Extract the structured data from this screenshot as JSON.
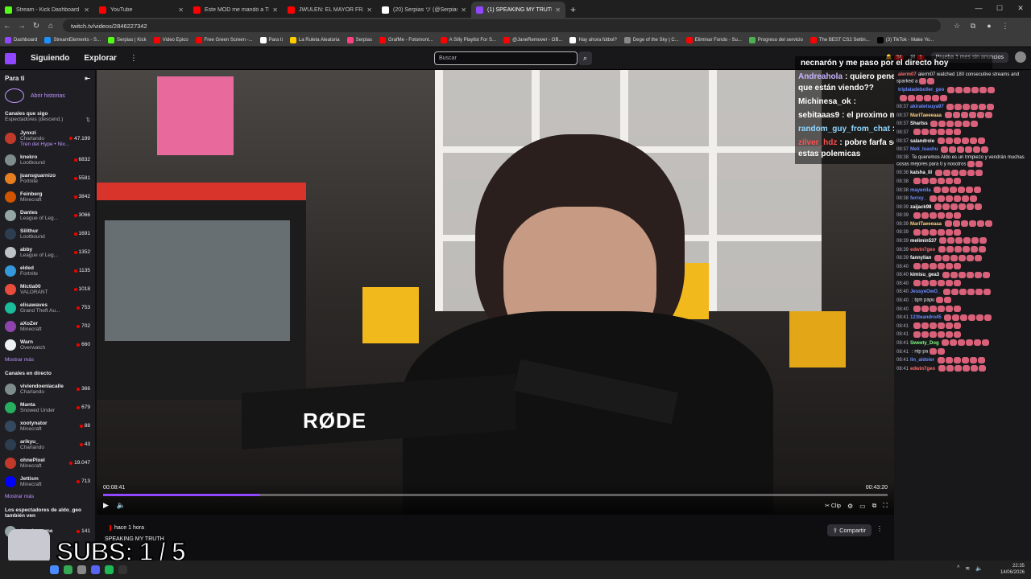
{
  "browser": {
    "tabs": [
      {
        "title": "Stream - Kick Dashboard",
        "color": "#53fc18",
        "active": false
      },
      {
        "title": "YouTube",
        "color": "#ff0000",
        "active": false
      },
      {
        "title": "Este MOD me mandó a TERAPIA",
        "color": "#ff0000",
        "active": false
      },
      {
        "title": "JWULEN: EL MAYOR FRAUDE DE",
        "color": "#ff0000",
        "active": false
      },
      {
        "title": "(20) Serpias ツ (@Serpias) / X",
        "color": "#ffffff",
        "active": false
      },
      {
        "title": "(1) SPEAKING MY TRUTH -",
        "color": "#9147ff",
        "active": true
      }
    ],
    "new_tab": "+",
    "url": "twitch.tv/videos/2846227342",
    "bookmarks": [
      {
        "label": "Dashboard",
        "color": "#9147ff"
      },
      {
        "label": "StreamElements - S...",
        "color": "#1e90ff"
      },
      {
        "label": "Serpias | Kick",
        "color": "#53fc18"
      },
      {
        "label": "Video Epico",
        "color": "#ff0000"
      },
      {
        "label": "Free Green Screen -...",
        "color": "#ff0000"
      },
      {
        "label": "Para ti",
        "color": "#ffffff"
      },
      {
        "label": "La Ruleta Aleatoria",
        "color": "#ffcc00"
      },
      {
        "label": "Serpias",
        "color": "#ff4081"
      },
      {
        "label": "GrafMe - Fotomont...",
        "color": "#ff0000"
      },
      {
        "label": "A Silly Playlist For S...",
        "color": "#ff0000"
      },
      {
        "label": "@JaneRemover - OB...",
        "color": "#ff0000"
      },
      {
        "label": "Hay ahora fútbol?",
        "color": "#ffffff"
      },
      {
        "label": "Dege of the Sky | C...",
        "color": "#888888"
      },
      {
        "label": "Eliminar Fondo - Su...",
        "color": "#ff0000"
      },
      {
        "label": "Progreso del servicio",
        "color": "#4caf50"
      },
      {
        "label": "The BEST CS2 Settin...",
        "color": "#ff0000"
      },
      {
        "label": "(3) TikTok - Make Yo...",
        "color": "#000000"
      }
    ]
  },
  "twitch": {
    "nav_following": "Siguiendo",
    "nav_browse": "Explorar",
    "nav_more": "⋮",
    "search_placeholder": "Buscar",
    "notif_count_1": "34",
    "notif_count_2": "1",
    "prime_label": "Prueba 1 mes sin anuncios"
  },
  "sidebar": {
    "title": "Para ti",
    "history_label": "Abrir historias",
    "followed_title": "Canales que sigo",
    "followed_sort": "Espectadores (descend.)",
    "followed": [
      {
        "name": "Jynxzi",
        "game": "Charlando",
        "viewers": "47.199",
        "extra": "Tren del Hype • Niv...",
        "color": "#c0392b"
      },
      {
        "name": "knekro",
        "game": "Lootbound",
        "viewers": "6832",
        "color": "#7f8c8d"
      },
      {
        "name": "juansguarnizo",
        "game": "Fortnite",
        "viewers": "5581",
        "color": "#e67e22"
      },
      {
        "name": "Feinberg",
        "game": "Minecraft",
        "viewers": "3842",
        "color": "#d35400"
      },
      {
        "name": "Dantes",
        "game": "League of Leg...",
        "viewers": "3066",
        "color": "#95a5a6"
      },
      {
        "name": "Silithur",
        "game": "Lootbound",
        "viewers": "1691",
        "color": "#2c3e50"
      },
      {
        "name": "abby",
        "game": "League of Leg...",
        "viewers": "1352",
        "color": "#bdc3c7"
      },
      {
        "name": "elded",
        "game": "Fortnite",
        "viewers": "1135",
        "color": "#3498db"
      },
      {
        "name": "Mictia00",
        "game": "VALORANT",
        "viewers": "1018",
        "color": "#e74c3c"
      },
      {
        "name": "elisawaves",
        "game": "Grand Theft Au...",
        "viewers": "753",
        "color": "#1abc9c"
      },
      {
        "name": "aXoZer",
        "game": "Minecraft",
        "viewers": "702",
        "color": "#8e44ad"
      },
      {
        "name": "Warn",
        "game": "Overwatch",
        "viewers": "660",
        "color": "#ecf0f1"
      }
    ],
    "show_more_1": "Mostrar más",
    "live_title": "Canales en directo",
    "live": [
      {
        "name": "viviendoenlacalle",
        "game": "Charlando",
        "viewers": "366",
        "color": "#7f8c8d"
      },
      {
        "name": "Manta",
        "game": "Snowed Under",
        "viewers": "679",
        "color": "#27ae60"
      },
      {
        "name": "xootynator",
        "game": "Minecraft",
        "viewers": "88",
        "color": "#34495e"
      },
      {
        "name": "arikyu_",
        "game": "Charlando",
        "viewers": "43",
        "color": "#2c3e50"
      },
      {
        "name": "ohnePixel",
        "game": "Minecraft",
        "viewers": "19.047",
        "color": "#c0392b"
      },
      {
        "name": "Jettism",
        "game": "Minecraft",
        "viewers": "713",
        "color": "#0000ff"
      }
    ],
    "show_more_2": "Mostrar más",
    "also_watch_title": "Los espectadores de aldo_geo también ven",
    "also_watch": [
      {
        "name": "Ataplaygame",
        "viewers": "141",
        "color": "#95a5a6"
      }
    ]
  },
  "video": {
    "brand": "RØDE",
    "time_current": "00:08:41",
    "time_total": "00:43:20",
    "progress": 0.2,
    "clip_label": "Clip",
    "posted": "hace 1 hora",
    "title": "SPEAKING MY TRUTH",
    "share_label": "Compartir",
    "subs_overlay": "SUBS: 1 / 5"
  },
  "overlay_chat": [
    {
      "user": "",
      "text": "necnarón y me paso por el directo hoy",
      "color": "#ffffff"
    },
    {
      "user": "Andreahola",
      "text": ": quiero pene     chat acabo de volver que están viendo??",
      "color": "#c8b6ff"
    },
    {
      "user": "Michinesa_ok",
      "text": ":",
      "color": "#ffffff"
    },
    {
      "user": "sebitaaas9",
      "text": ": el proximo mes es desafio no creo",
      "color": "#ffffff"
    },
    {
      "user": "random_guy_from_chat",
      "text": ": mal ahi bro",
      "color": "#8fd7ff"
    },
    {
      "user": "zilver_hdz",
      "text": ": pobre farfa se va pegar un tiro con estas polemicas",
      "color": "#ff4d4d"
    }
  ],
  "chat": [
    {
      "ts": "",
      "user": "alerm07",
      "text": "alerm07 watched 180 consecutive streams and sparked a",
      "color": "#ff6b6b"
    },
    {
      "ts": "",
      "user": "triplatadeboller_geo",
      "text": "",
      "color": "#6c8cff"
    },
    {
      "ts": "",
      "user": "",
      "text": "",
      "color": "#ffffff"
    },
    {
      "ts": "08:37",
      "user": "akiratetsuya97",
      "text": "",
      "color": "#6c8cff"
    },
    {
      "ts": "08:37",
      "user": "MariTaeeeaaa",
      "text": "",
      "color": "#ffd27f"
    },
    {
      "ts": "08:37",
      "user": "Sharlss",
      "text": "",
      "color": "#ffffff"
    },
    {
      "ts": "08:37",
      "user": "",
      "text": "",
      "color": "#ffffff"
    },
    {
      "ts": "08:37",
      "user": "salandroie",
      "text": "",
      "color": "#ffffff"
    },
    {
      "ts": "08:37",
      "user": "Meli_luashu",
      "text": "",
      "color": "#6c8cff"
    },
    {
      "ts": "08:38",
      "user": "",
      "text": "Te queremos Aldo es un trmpiezo y vendrán muchas cosas mejores para ti y nosotros",
      "color": "#6c8cff"
    },
    {
      "ts": "08:38",
      "user": "kaisha_lil",
      "text": "",
      "color": "#ffffff"
    },
    {
      "ts": "08:38",
      "user": "",
      "text": "",
      "color": "#ffffff"
    },
    {
      "ts": "08:38",
      "user": "mayenila",
      "text": "",
      "color": "#6c8cff"
    },
    {
      "ts": "08:38",
      "user": "ferrxy_",
      "text": "",
      "color": "#6c8cff"
    },
    {
      "ts": "08:39",
      "user": "zaijack98",
      "text": "",
      "color": "#ffffff"
    },
    {
      "ts": "08:39",
      "user": "",
      "text": "",
      "color": "#ffffff"
    },
    {
      "ts": "08:39",
      "user": "MariTaeeeaaa",
      "text": "",
      "color": "#ffd27f"
    },
    {
      "ts": "08:39",
      "user": "",
      "text": "",
      "color": "#ffffff"
    },
    {
      "ts": "08:39",
      "user": "melimin537",
      "text": "",
      "color": "#ffffff"
    },
    {
      "ts": "08:39",
      "user": "edwin7geo",
      "text": "",
      "color": "#ff6b6b"
    },
    {
      "ts": "08:39",
      "user": "fannyllan",
      "text": "",
      "color": "#ffffff"
    },
    {
      "ts": "08:40",
      "user": "",
      "text": "",
      "color": "#ffffff"
    },
    {
      "ts": "08:40",
      "user": "kimisu_gea3",
      "text": "",
      "color": "#ffffff"
    },
    {
      "ts": "08:40",
      "user": "",
      "text": "",
      "color": "#ffffff"
    },
    {
      "ts": "08:40",
      "user": "JessyeOwO_",
      "text": "",
      "color": "#6c8cff"
    },
    {
      "ts": "08:40",
      "user": "",
      "text": ": tqm papu",
      "color": "#ffffff"
    },
    {
      "ts": "08:40",
      "user": "",
      "text": "",
      "color": "#ffffff"
    },
    {
      "ts": "08:41",
      "user": "123teandro45",
      "text": "",
      "color": "#6c8cff"
    },
    {
      "ts": "08:41",
      "user": "",
      "text": "",
      "color": "#ffffff"
    },
    {
      "ts": "08:41",
      "user": "",
      "text": "",
      "color": "#ffffff"
    },
    {
      "ts": "08:41",
      "user": "Sweety_Dog",
      "text": "",
      "color": "#7fff7f"
    },
    {
      "ts": "08:41",
      "user": "",
      "text": ": ntp pa",
      "color": "#ffffff"
    },
    {
      "ts": "08:41",
      "user": "lin_aldoier",
      "text": "",
      "color": "#6c8cff"
    },
    {
      "ts": "08:41",
      "user": "edwin7geo",
      "text": "",
      "color": "#ff6b6b"
    }
  ],
  "taskbar": {
    "time": "22:35",
    "date": "14/06/2026"
  }
}
